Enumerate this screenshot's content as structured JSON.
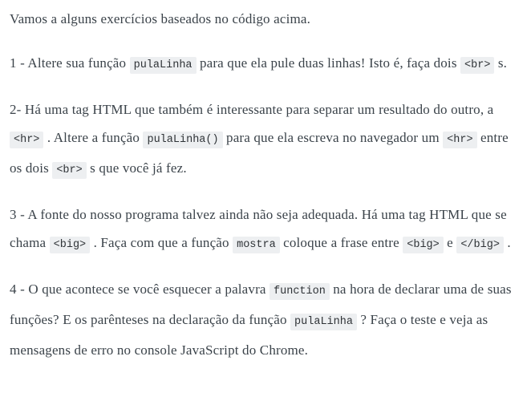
{
  "document": {
    "colors": {
      "background": "#ffffff",
      "text": "#3b434a",
      "code_background": "#edeff1",
      "code_text": "#2f3337"
    },
    "paragraphs": [
      {
        "id": "intro",
        "segments": [
          {
            "type": "text",
            "value": "Vamos a alguns exercícios baseados no código acima."
          }
        ]
      },
      {
        "id": "exercise-1",
        "segments": [
          {
            "type": "text",
            "value": "1 - Altere sua função "
          },
          {
            "type": "code",
            "value": "pulaLinha"
          },
          {
            "type": "text",
            "value": " para que ela pule duas linhas! Isto é, faça dois "
          },
          {
            "type": "code",
            "value": "<br>"
          },
          {
            "type": "text",
            "value": " s."
          }
        ]
      },
      {
        "id": "exercise-2",
        "segments": [
          {
            "type": "text",
            "value": "2- Há uma tag HTML que também é interessante para separar um resultado do outro, a "
          },
          {
            "type": "code",
            "value": "<hr>"
          },
          {
            "type": "text",
            "value": " . Altere a função "
          },
          {
            "type": "code",
            "value": "pulaLinha()"
          },
          {
            "type": "text",
            "value": " para que ela escreva no navegador um "
          },
          {
            "type": "code",
            "value": "<hr>"
          },
          {
            "type": "text",
            "value": " entre os dois "
          },
          {
            "type": "code",
            "value": "<br>"
          },
          {
            "type": "text",
            "value": " s que você já fez."
          }
        ]
      },
      {
        "id": "exercise-3",
        "segments": [
          {
            "type": "text",
            "value": "3 - A fonte do nosso programa talvez ainda não seja adequada. Há uma tag HTML que se chama "
          },
          {
            "type": "code",
            "value": "<big>"
          },
          {
            "type": "text",
            "value": " . Faça com que a função "
          },
          {
            "type": "code",
            "value": "mostra"
          },
          {
            "type": "text",
            "value": " coloque a frase entre "
          },
          {
            "type": "code",
            "value": "<big>"
          },
          {
            "type": "text",
            "value": " e "
          },
          {
            "type": "code",
            "value": "</big>"
          },
          {
            "type": "text",
            "value": " ."
          }
        ]
      },
      {
        "id": "exercise-4",
        "segments": [
          {
            "type": "text",
            "value": "4 - O que acontece se você esquecer a palavra "
          },
          {
            "type": "code",
            "value": "function"
          },
          {
            "type": "text",
            "value": " na hora de declarar uma de suas funções? E os parênteses na declaração da função "
          },
          {
            "type": "code",
            "value": "pulaLinha"
          },
          {
            "type": "text",
            "value": " ? Faça o teste e veja as mensagens de erro no console JavaScript do Chrome."
          }
        ]
      }
    ]
  }
}
